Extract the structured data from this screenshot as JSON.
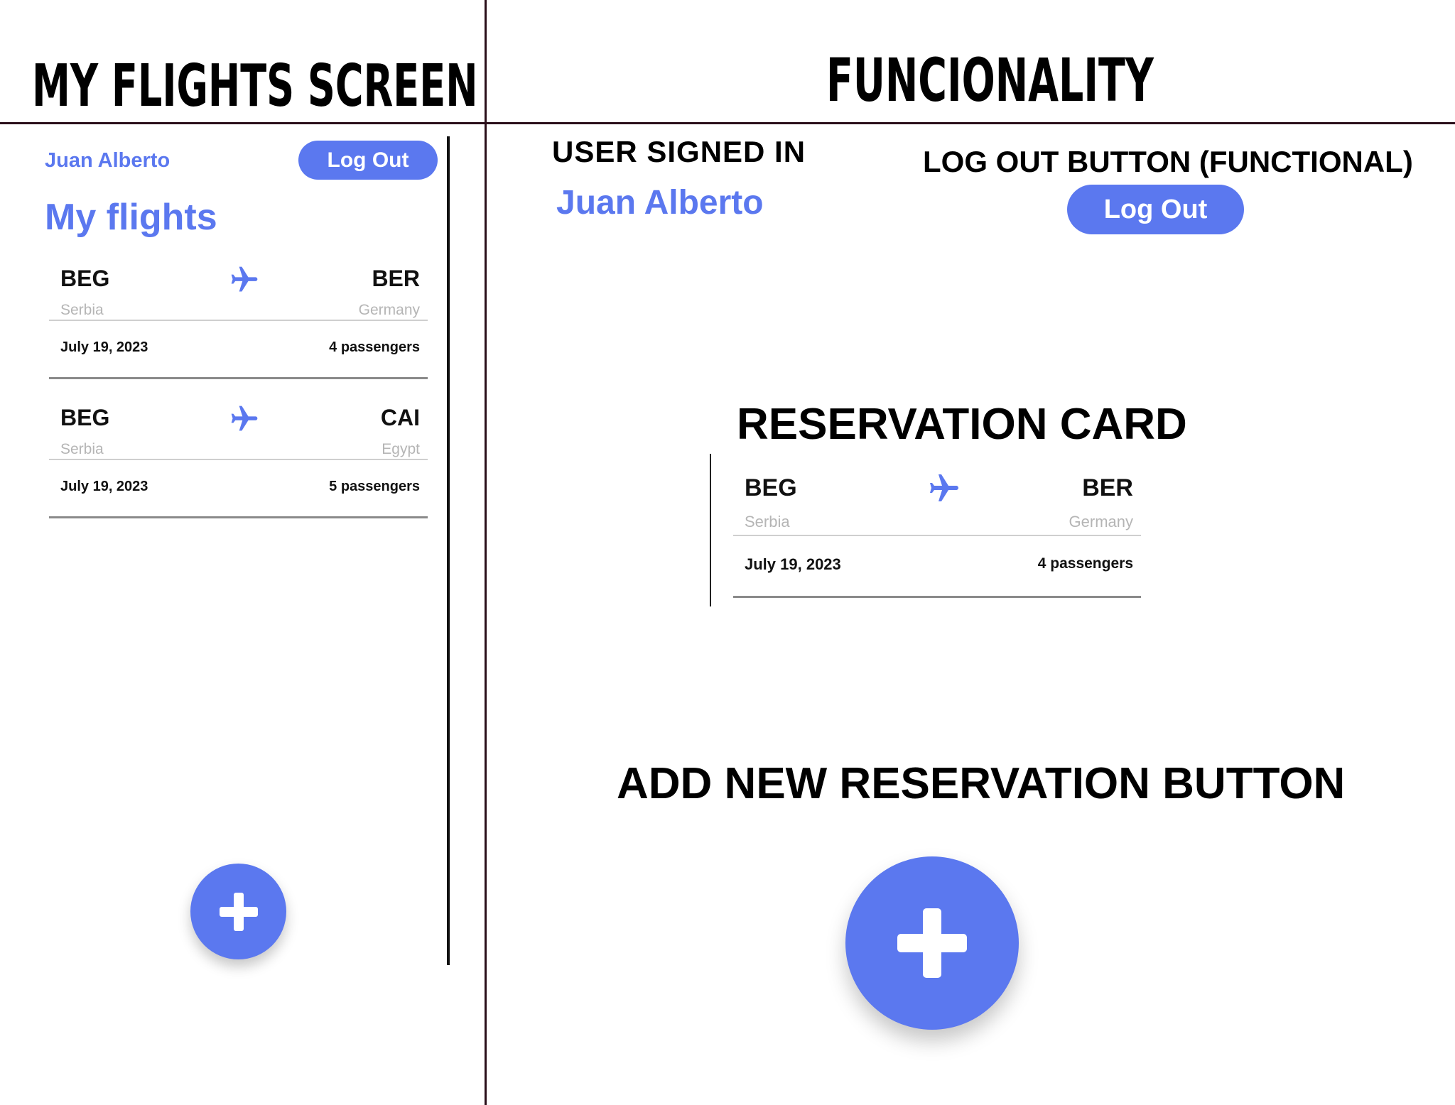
{
  "headings": {
    "my_flights_screen": "MY FLIGHTS SCREEN",
    "functionality": "FUNCIONALITY",
    "user_signed_in": "USER SIGNED IN",
    "logout_button": "LOG OUT BUTTON (FUNCTIONAL)",
    "reservation_card": "RESERVATION CARD",
    "add_reservation_button": "ADD NEW RESERVATION BUTTON"
  },
  "colors": {
    "accent": "#5b78ef",
    "divider": "#2a0f1a"
  },
  "app": {
    "user_name": "Juan Alberto",
    "logout_label": "Log Out",
    "page_title": "My flights",
    "add_icon": "plus-icon",
    "flights": [
      {
        "from_code": "BEG",
        "from_country": "Serbia",
        "to_code": "BER",
        "to_country": "Germany",
        "date": "July 19, 2023",
        "passengers": "4 passengers",
        "icon": "airplane-icon"
      },
      {
        "from_code": "BEG",
        "from_country": "Serbia",
        "to_code": "CAI",
        "to_country": "Egypt",
        "date": "July 19, 2023",
        "passengers": "5 passengers",
        "icon": "airplane-icon"
      }
    ]
  },
  "example_card": {
    "from_code": "BEG",
    "from_country": "Serbia",
    "to_code": "BER",
    "to_country": "Germany",
    "date": "July 19, 2023",
    "passengers": "4 passengers",
    "icon": "airplane-icon"
  }
}
